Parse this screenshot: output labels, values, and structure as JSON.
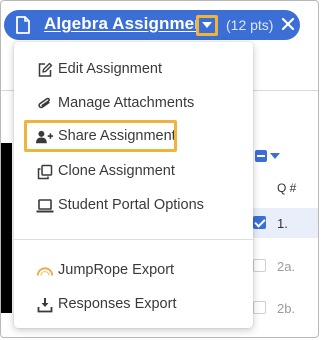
{
  "header": {
    "title": "Algebra Assignment",
    "points": "(12 pts)",
    "close_icon": "close-icon",
    "doc_icon": "document-icon",
    "caret_icon": "caret-down-icon",
    "pill_color": "#3b6fd6",
    "highlight_color": "#f0b43c"
  },
  "menu": {
    "items": [
      {
        "label": "Edit Assignment",
        "icon": "edit-icon"
      },
      {
        "label": "Manage Attachments",
        "icon": "paperclip-icon"
      },
      {
        "label": "Share Assignment",
        "icon": "add-user-icon",
        "highlighted": true
      },
      {
        "label": "Clone Assignment",
        "icon": "clone-icon"
      },
      {
        "label": "Student Portal Options",
        "icon": "laptop-icon"
      }
    ],
    "export_items": [
      {
        "label": "JumpRope Export",
        "icon": "jumprope-icon"
      },
      {
        "label": "Responses Export",
        "icon": "download-icon"
      }
    ]
  },
  "background": {
    "q_header": "Q #",
    "rows": [
      {
        "q": "1.",
        "checked": true
      },
      {
        "q": "2a.",
        "checked": false
      },
      {
        "q": "2b.",
        "checked": false
      }
    ]
  }
}
